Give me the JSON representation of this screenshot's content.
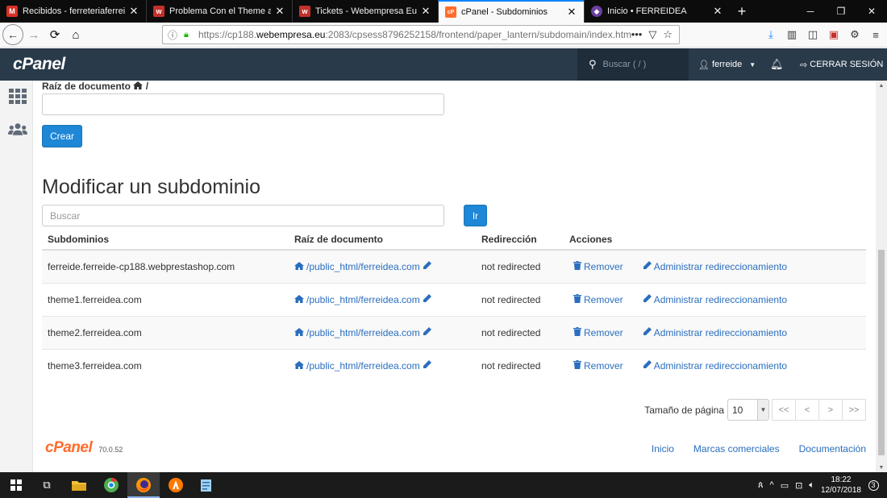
{
  "browser": {
    "tabs": [
      {
        "title": "Recibidos - ferreteriaferreidea@",
        "favicon_color": "#d93025",
        "favicon": "M",
        "active": false
      },
      {
        "title": "Problema Con el Theme al crea",
        "favicon_color": "#c4302b",
        "favicon": "w",
        "active": false
      },
      {
        "title": "Tickets - Webempresa Europa",
        "favicon_color": "#c4302b",
        "favicon": "w",
        "active": false
      },
      {
        "title": "cPanel - Subdominios",
        "favicon_color": "#ff6c2c",
        "favicon": "cP",
        "active": true
      },
      {
        "title": "Inicio • FERREIDEA",
        "favicon_color": "#6b3fa0",
        "favicon": "◆",
        "active": false
      }
    ],
    "url_prefix": "https://cp188.",
    "url_host": "webempresa.eu",
    "url_rest": ":2083/cpsess8796252158/frontend/paper_lantern/subdomain/index.html"
  },
  "cpanel": {
    "logo": "cPanel",
    "search_placeholder": "Buscar ( / )",
    "user": "ferreide",
    "logout": "CERRAR SESIÓN",
    "brand_color": "#293a4a"
  },
  "create": {
    "root_label": "Raíz de documento",
    "root_suffix": "/",
    "button": "Crear"
  },
  "modify": {
    "heading": "Modificar un subdominio",
    "search_placeholder": "Buscar",
    "go_button": "Ir",
    "columns": [
      "Subdominios",
      "Raíz de documento",
      "Redirección",
      "Acciones"
    ],
    "rows": [
      {
        "subdomain": "ferreide.ferreide-cp188.webprestashop.com",
        "root": "/public_html/ferreidea.com",
        "redirect": "not redirected",
        "remove": "Remover",
        "manage": "Administrar redireccionamiento"
      },
      {
        "subdomain": "theme1.ferreidea.com",
        "root": "/public_html/ferreidea.com",
        "redirect": "not redirected",
        "remove": "Remover",
        "manage": "Administrar redireccionamiento"
      },
      {
        "subdomain": "theme2.ferreidea.com",
        "root": "/public_html/ferreidea.com",
        "redirect": "not redirected",
        "remove": "Remover",
        "manage": "Administrar redireccionamiento"
      },
      {
        "subdomain": "theme3.ferreidea.com",
        "root": "/public_html/ferreidea.com",
        "redirect": "not redirected",
        "remove": "Remover",
        "manage": "Administrar redireccionamiento"
      }
    ],
    "pager": {
      "label": "Tamaño de página",
      "size": "10",
      "buttons": [
        "<<",
        "<",
        ">",
        ">>"
      ]
    }
  },
  "footer": {
    "logo": "cPanel",
    "version": "70.0.52",
    "links": [
      "Inicio",
      "Marcas comerciales",
      "Documentación"
    ]
  },
  "taskbar": {
    "time": "18:22",
    "date": "12/07/2018",
    "notifications": "3"
  }
}
